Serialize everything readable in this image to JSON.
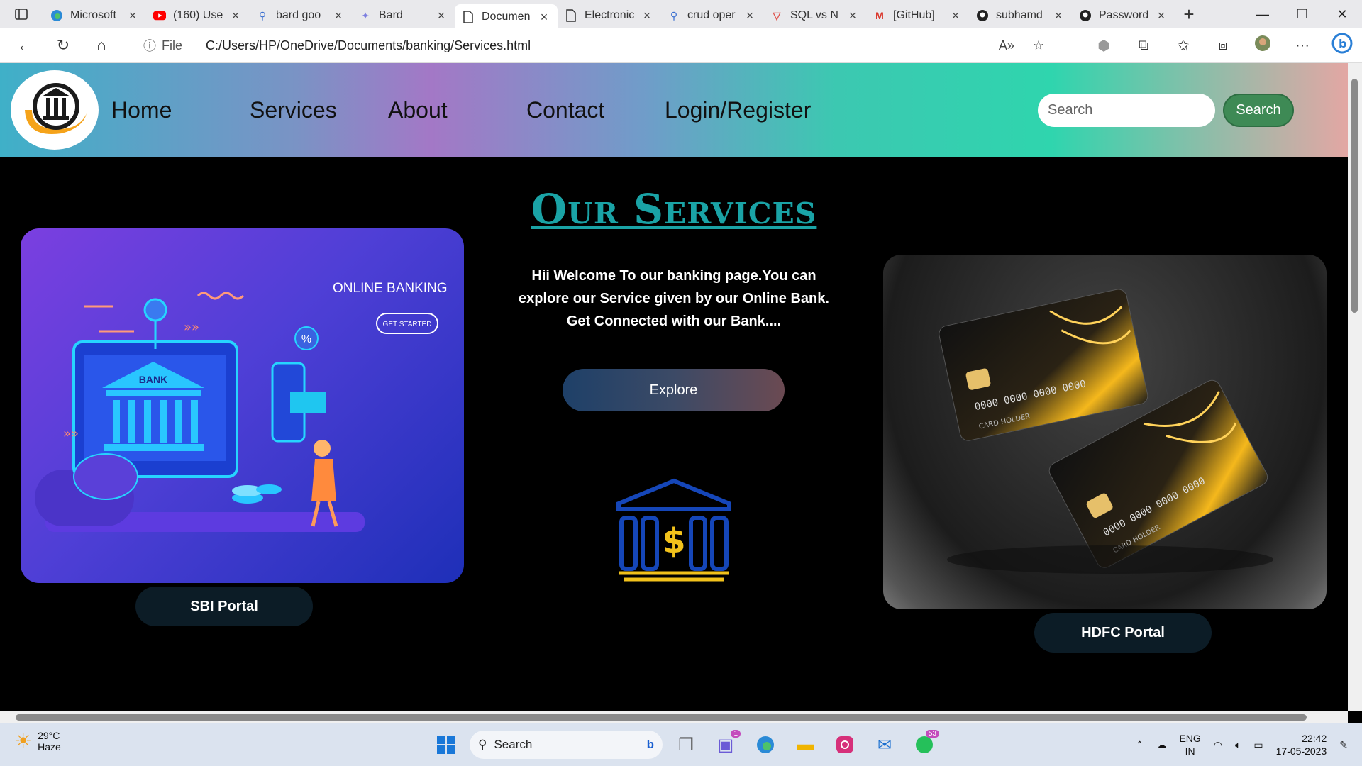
{
  "browser": {
    "tabs": [
      {
        "title": "Microsoft",
        "icon": "edge-icon"
      },
      {
        "title": "(160) Use",
        "icon": "youtube-icon"
      },
      {
        "title": "bard goo",
        "icon": "search-icon"
      },
      {
        "title": "Bard",
        "icon": "bard-icon"
      },
      {
        "title": "Documen",
        "icon": "document-icon"
      },
      {
        "title": "Electronic",
        "icon": "document-icon"
      },
      {
        "title": "crud oper",
        "icon": "search-icon"
      },
      {
        "title": "SQL vs N",
        "icon": "v-icon"
      },
      {
        "title": "[GitHub] ",
        "icon": "gmail-icon"
      },
      {
        "title": "subhamd",
        "icon": "github-icon"
      },
      {
        "title": "Password",
        "icon": "github-icon"
      }
    ],
    "active_tab_index": 4,
    "address": {
      "scheme_label": "File",
      "url": "C:/Users/HP/OneDrive/Documents/banking/Services.html"
    }
  },
  "site": {
    "nav": {
      "home": "Home",
      "services": "Services",
      "about": "About",
      "contact": "Contact",
      "login": "Login/Register"
    },
    "search_placeholder": "Search",
    "search_button": "Search",
    "heading": "Our Services",
    "welcome_lines": [
      "Hii Welcome To our banking page.You can",
      "explore our Service given by our Online Bank.",
      "Get Connected with our Bank...."
    ],
    "explore_button": "Explore",
    "left_card": {
      "title": "ONLINE BANKING",
      "cta": "GET STARTED",
      "bank_label": "BANK",
      "portal_button": "SBI Portal"
    },
    "right_card": {
      "card_digits": "0000 0000 0000 0000",
      "card_holder": "CARD HOLDER",
      "portal_button": "HDFC Portal"
    }
  },
  "taskbar": {
    "weather_temp": "29°C",
    "weather_desc": "Haze",
    "search_label": "Search",
    "teams_badge": "1",
    "whatsapp_badge": "53",
    "lang_top": "ENG",
    "lang_bottom": "IN",
    "time": "22:42",
    "date": "17-05-2023"
  },
  "colors": {
    "heading": "#1aa3a6",
    "search_button": "#3e8a55",
    "portal_button": "#0c1c26"
  }
}
